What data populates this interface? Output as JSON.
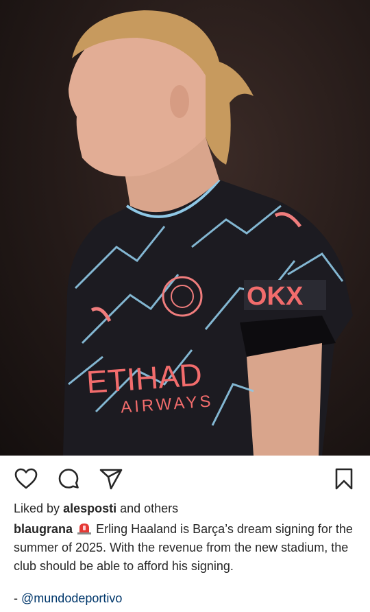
{
  "post": {
    "image": {
      "alt_subject": "football-player-photo",
      "shirt_sponsor": "ETIHAD",
      "shirt_sponsor_sub": "AIRWAYS",
      "sleeve_sponsor": "OKX"
    },
    "actions": {
      "like_icon": "heart-icon",
      "comment_icon": "comment-bubble-icon",
      "share_icon": "paper-plane-icon",
      "save_icon": "bookmark-icon"
    },
    "likes": {
      "prefix": "Liked by",
      "user": "alesposti",
      "suffix": "and others"
    },
    "caption": {
      "author": "blaugrana",
      "emoji": "siren-emoji",
      "text": "Erling Haaland is Barça’s dream signing for the summer of 2025. With the revenue from the new stadium, the club should be able to afford his signing."
    },
    "credit": {
      "prefix": "-",
      "handle": "@mundodeportivo"
    }
  }
}
